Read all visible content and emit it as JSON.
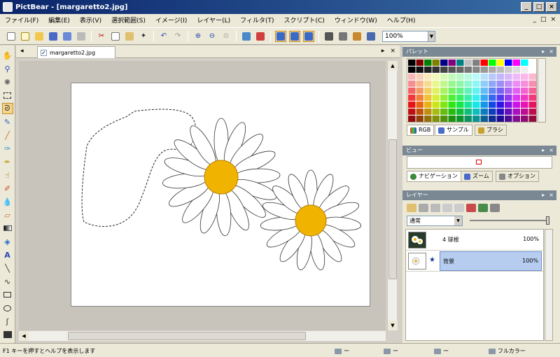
{
  "window": {
    "title": "PictBear - [margaretto2.jpg]"
  },
  "menu": {
    "items": [
      "ファイル(F)",
      "編集(E)",
      "表示(V)",
      "選択範囲(S)",
      "イメージ(I)",
      "レイヤー(L)",
      "フィルタ(T)",
      "スクリプト(C)",
      "ウィンドウ(W)",
      "ヘルプ(H)"
    ],
    "mdi": [
      "_",
      "□",
      "×"
    ]
  },
  "toolbar": {
    "zoom": "100%"
  },
  "document": {
    "tab_label": "margaretto2.jpg",
    "tab_check": "✓"
  },
  "palette": {
    "title": "パレット",
    "tabs": [
      "RGB",
      "サンプル",
      "ブラシ"
    ]
  },
  "view": {
    "title": "ビュー",
    "tabs": [
      "ナビゲーション",
      "ズーム",
      "オプション"
    ]
  },
  "layers": {
    "title": "レイヤー",
    "blend_mode": "通常",
    "rows": [
      {
        "name": "4 球根",
        "opacity": "100%"
      },
      {
        "name": "背景",
        "opacity": "100%"
      }
    ]
  },
  "status": {
    "help": "F1 キーを押すとヘルプを表示します",
    "size": "ー",
    "position": "ー",
    "selection": "ー",
    "color_mode": "フルカラー"
  },
  "colors": {
    "title_start": "#0a246a",
    "selection": "#b7cdf0",
    "flower_center": "#f0b400"
  }
}
